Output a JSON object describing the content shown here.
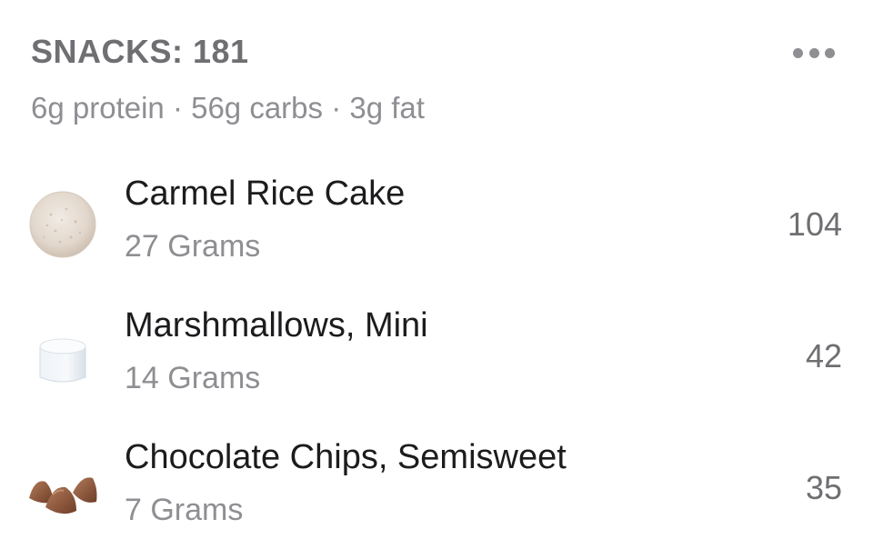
{
  "meal": {
    "title": "SNACKS: 181",
    "macros": "6g protein · 56g carbs · 3g fat",
    "more_icon": "more-horizontal-icon"
  },
  "foods": [
    {
      "name": "Carmel Rice Cake",
      "amount": "27 Grams",
      "calories": "104",
      "icon": "rice-cake-icon"
    },
    {
      "name": "Marshmallows, Mini",
      "amount": "14 Grams",
      "calories": "42",
      "icon": "marshmallow-icon"
    },
    {
      "name": "Chocolate Chips, Semisweet",
      "amount": "7 Grams",
      "calories": "35",
      "icon": "chocolate-chips-icon"
    }
  ],
  "colors": {
    "title": "#6f6f73",
    "secondary": "#8e8e93",
    "primary_text": "#1c1c1e",
    "background": "#ffffff"
  }
}
